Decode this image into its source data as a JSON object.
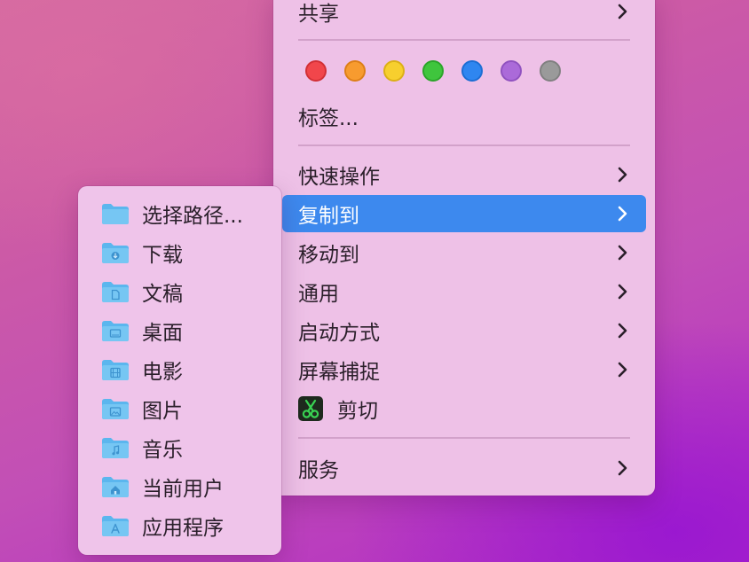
{
  "main_menu": {
    "share": "共享",
    "tags_label": "标签...",
    "tag_colors": [
      {
        "name": "red",
        "fill": "#f1464b",
        "stroke": "#d23036"
      },
      {
        "name": "orange",
        "fill": "#f79b2f",
        "stroke": "#dd7f17"
      },
      {
        "name": "yellow",
        "fill": "#f7cf2e",
        "stroke": "#dcb016"
      },
      {
        "name": "green",
        "fill": "#3fc53d",
        "stroke": "#2ba52a"
      },
      {
        "name": "blue",
        "fill": "#2f86f0",
        "stroke": "#1c6ed4"
      },
      {
        "name": "purple",
        "fill": "#ab6ad9",
        "stroke": "#9052c0"
      },
      {
        "name": "gray",
        "fill": "#9a9a9a",
        "stroke": "#808080"
      }
    ],
    "quick_actions": "快速操作",
    "copy_to": "复制到",
    "move_to": "移动到",
    "general": "通用",
    "open_with": "启动方式",
    "screen_capture": "屏幕捕捉",
    "cut": "剪切",
    "services": "服务"
  },
  "sub_menu": {
    "items": [
      {
        "label": "选择路径...",
        "icon": "folder-icon"
      },
      {
        "label": "下载",
        "icon": "downloads-folder-icon"
      },
      {
        "label": "文稿",
        "icon": "documents-folder-icon"
      },
      {
        "label": "桌面",
        "icon": "desktop-folder-icon"
      },
      {
        "label": "电影",
        "icon": "movies-folder-icon"
      },
      {
        "label": "图片",
        "icon": "pictures-folder-icon"
      },
      {
        "label": "音乐",
        "icon": "music-folder-icon"
      },
      {
        "label": "当前用户",
        "icon": "home-folder-icon"
      },
      {
        "label": "应用程序",
        "icon": "applications-folder-icon"
      }
    ]
  },
  "colors": {
    "highlight": "#3d89ee",
    "menu_bg": "#eec1e7",
    "folder": "#5bb6ee"
  }
}
